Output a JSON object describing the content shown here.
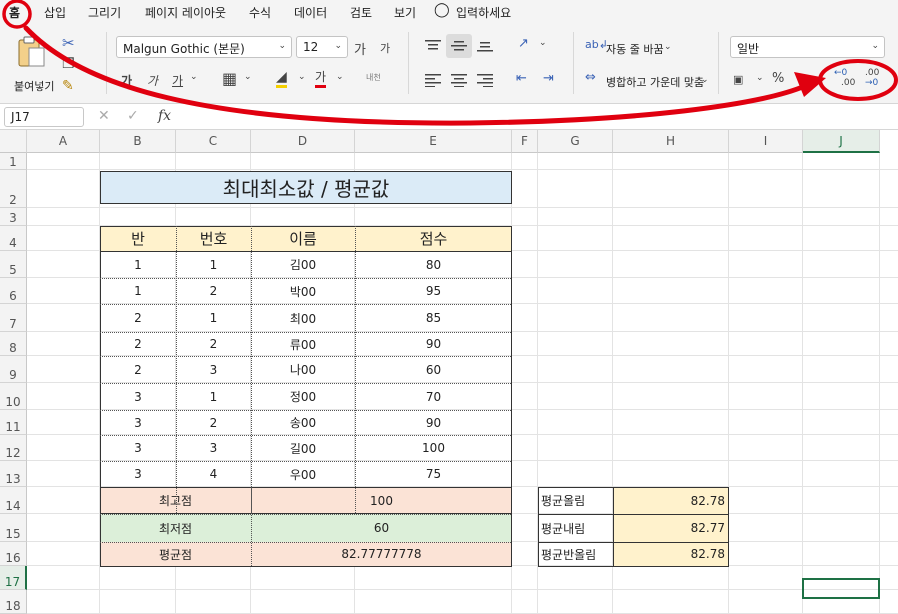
{
  "menu": [
    "홈",
    "삽입",
    "그리기",
    "페이지 레이아웃",
    "수식",
    "데이터",
    "검토",
    "보기"
  ],
  "tell_me": "입력하세요",
  "ribbon": {
    "paste_label": "붙여넣기",
    "font_name": "Malgun Gothic (본문)",
    "font_size": "12",
    "grow_font": "가",
    "shrink_font": "가",
    "bold": "가",
    "italic": "가",
    "underline": "가",
    "font_color": "가",
    "phonetic": "내천",
    "wrap_text": "자동 줄 바꿈",
    "merge_center": "병합하고 가운데 맞춤",
    "number_format": "일반",
    "percent": "%",
    "comma": "9",
    "dec_increase_top": "←0",
    "dec_increase_bottom": ".00",
    "dec_decrease_top": ".00",
    "dec_decrease_bottom": "→0"
  },
  "formula_bar": {
    "name_box": "J17",
    "fx": "fx",
    "formula": ""
  },
  "columns": [
    "A",
    "B",
    "C",
    "D",
    "E",
    "F",
    "G",
    "H",
    "I",
    "J"
  ],
  "rows": [
    "1",
    "2",
    "3",
    "4",
    "5",
    "6",
    "7",
    "8",
    "9",
    "10",
    "11",
    "12",
    "13",
    "14",
    "15",
    "16",
    "17",
    "18"
  ],
  "title": "최대최소값 / 평균값",
  "table": {
    "headers": [
      "반",
      "번호",
      "이름",
      "점수"
    ],
    "rows": [
      [
        "1",
        "1",
        "김00",
        "80"
      ],
      [
        "1",
        "2",
        "박00",
        "95"
      ],
      [
        "2",
        "1",
        "최00",
        "85"
      ],
      [
        "2",
        "2",
        "류00",
        "90"
      ],
      [
        "2",
        "3",
        "나00",
        "60"
      ],
      [
        "3",
        "1",
        "정00",
        "70"
      ],
      [
        "3",
        "2",
        "송00",
        "90"
      ],
      [
        "3",
        "3",
        "길00",
        "100"
      ],
      [
        "3",
        "4",
        "우00",
        "75"
      ]
    ]
  },
  "summary": [
    {
      "label": "최고점",
      "value": "100",
      "color": "#fbe3d6"
    },
    {
      "label": "최저점",
      "value": "60",
      "color": "#dcefd9"
    },
    {
      "label": "평균점",
      "value": "82.77777778",
      "color": "#fbe3d6"
    }
  ],
  "rounding": [
    {
      "label": "평균올림",
      "value": "82.78"
    },
    {
      "label": "평균내림",
      "value": "82.77"
    },
    {
      "label": "평균반올림",
      "value": "82.78"
    }
  ],
  "colors": {
    "title_fill": "#dbebf7",
    "header_fill": "#fff2cc",
    "rounding_fill": "#fff2cc",
    "annotation": "#e0000f",
    "selection": "#1e7145"
  }
}
